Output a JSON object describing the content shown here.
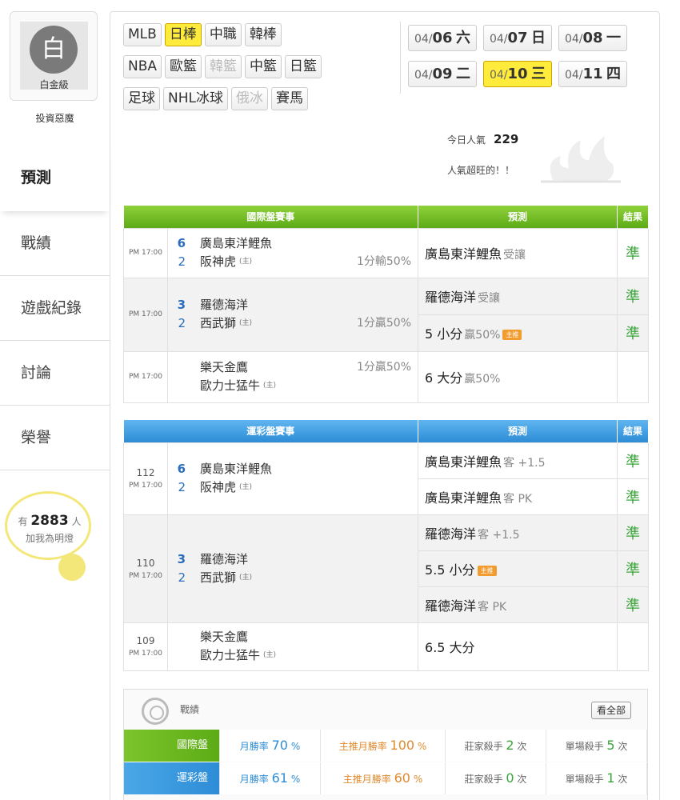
{
  "sidebar": {
    "rank_glyph": "白",
    "rank_label": "白金級",
    "username": "投資惡魔",
    "nav": [
      "預測",
      "戰績",
      "遊戲紀錄",
      "討論",
      "榮譽"
    ],
    "fans_prefix": "有",
    "fans_count": "2883",
    "fans_suffix": "人",
    "fans_text": "加我為明燈"
  },
  "leagues": [
    [
      "MLB",
      "日棒",
      "中職",
      "韓棒"
    ],
    [
      "NBA",
      "歐籃",
      "韓籃",
      "中籃",
      "日籃"
    ],
    [
      "足球",
      "NHL冰球",
      "俄冰",
      "賽馬"
    ]
  ],
  "dates": [
    [
      {
        "md": "04/",
        "d": "06",
        "w": "六"
      },
      {
        "md": "04/",
        "d": "07",
        "w": "日"
      },
      {
        "md": "04/",
        "d": "08",
        "w": "一"
      }
    ],
    [
      {
        "md": "04/",
        "d": "09",
        "w": "二"
      },
      {
        "md": "04/",
        "d": "10",
        "w": "三"
      },
      {
        "md": "04/",
        "d": "11",
        "w": "四"
      }
    ]
  ],
  "popularity": {
    "label": "今日人氣",
    "value": "229",
    "note": "人氣超旺的！！"
  },
  "intl": {
    "headers": [
      "國際盤賽事",
      "預測",
      "結果"
    ],
    "time": "PM 17:00",
    "home_mark": "(主)",
    "m1": {
      "s1": "6",
      "t1": "廣島東洋鯉魚",
      "s2": "2",
      "t2": "阪神虎",
      "hc": "1分輸50%",
      "pred": "廣島東洋鯉魚",
      "pred_note": "受讓",
      "res": "準"
    },
    "m2": {
      "s1": "3",
      "t1": "羅德海洋",
      "s2": "2",
      "t2": "西武獅",
      "hc": "1分贏50%",
      "pred1": "羅德海洋",
      "pred1_note": "受讓",
      "res1": "準",
      "pred2": "5 小分",
      "pred2_note": "贏50%",
      "badge": "主推",
      "res2": "準"
    },
    "m3": {
      "t1": "樂天金鷹",
      "t2": "歐力士猛牛",
      "hc": "1分贏50%",
      "pred": "6 大分",
      "pred_note": "贏50%"
    }
  },
  "sports": {
    "headers": [
      "運彩盤賽事",
      "預測",
      "結果"
    ],
    "time": "PM 17:00",
    "home_mark": "(主)",
    "m1": {
      "no": "112",
      "s1": "6",
      "t1": "廣島東洋鯉魚",
      "s2": "2",
      "t2": "阪神虎",
      "p1": "廣島東洋鯉魚",
      "p1n": "客 +1.5",
      "r1": "準",
      "p2": "廣島東洋鯉魚",
      "p2n": "客 PK",
      "r2": "準"
    },
    "m2": {
      "no": "110",
      "s1": "3",
      "t1": "羅德海洋",
      "s2": "2",
      "t2": "西武獅",
      "p1": "羅德海洋",
      "p1n": "客 +1.5",
      "r1": "準",
      "p2": "5.5 小分",
      "badge": "主推",
      "r2": "準",
      "p3": "羅德海洋",
      "p3n": "客 PK",
      "r3": "準"
    },
    "m3": {
      "no": "109",
      "t1": "樂天金鷹",
      "t2": "歐力士猛牛",
      "p1": "6.5 大分"
    }
  },
  "record": {
    "title": "戰績",
    "view_all": "看全部",
    "rows": [
      {
        "label": "國際盤",
        "c1l": "月勝率",
        "c1v": "70",
        "c1u": "%",
        "c2l": "主推月勝率",
        "c2v": "100",
        "c2u": "%",
        "c3l": "莊家殺手",
        "c3v": "2",
        "c3u": "次",
        "c4l": "單場殺手",
        "c4v": "5",
        "c4u": "次"
      },
      {
        "label": "運彩盤",
        "c1l": "月勝率",
        "c1v": "61",
        "c1u": "%",
        "c2l": "主推月勝率",
        "c2v": "60",
        "c2u": "%",
        "c3l": "莊家殺手",
        "c3v": "0",
        "c3u": "次",
        "c4l": "單場殺手",
        "c4v": "1",
        "c4u": "次"
      }
    ]
  },
  "colors": {
    "accent_yellow": "#ffeb3b",
    "intl_green": "#5cab16",
    "sports_blue": "#2d8cd6",
    "result_green": "#3aa53a"
  }
}
